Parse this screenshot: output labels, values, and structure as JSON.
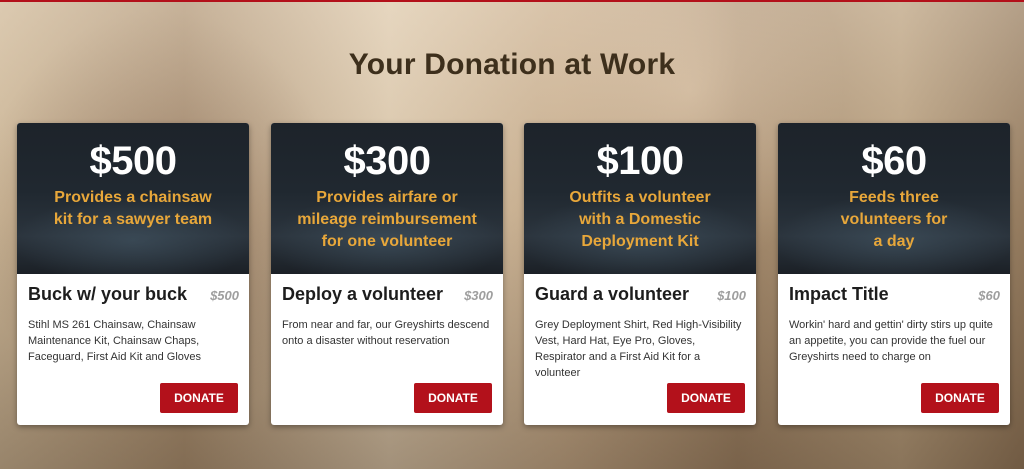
{
  "section": {
    "title": "Your Donation at Work"
  },
  "cards": [
    {
      "amount": "$500",
      "hero_text": "Provides a chainsaw kit for a sawyer team",
      "title": "Buck w/ your buck",
      "price": "$500",
      "description": "Stihl MS 261 Chainsaw, Chainsaw Maintenance Kit, Chainsaw Chaps, Faceguard, First Aid Kit and Gloves",
      "button": "DONATE"
    },
    {
      "amount": "$300",
      "hero_text": "Provides airfare or mileage reimbursement for one volunteer",
      "title": "Deploy a volunteer",
      "price": "$300",
      "description": "From near and far, our Greyshirts descend onto a disaster without reservation",
      "button": "DONATE"
    },
    {
      "amount": "$100",
      "hero_text": "Outfits a volunteer with a Domestic Deployment Kit",
      "title": "Guard a volunteer",
      "price": "$100",
      "description": "Grey Deployment Shirt, Red High-Visibility Vest, Hard Hat, Eye Pro, Gloves, Respirator and a First Aid Kit for a volunteer",
      "button": "DONATE"
    },
    {
      "amount": "$60",
      "hero_text": "Feeds three volunteers for a day",
      "title": "Impact Title",
      "price": "$60",
      "description": "Workin' hard and gettin' dirty stirs up quite an appetite, you can provide the fuel our Greyshirts need to charge on",
      "button": "DONATE"
    }
  ],
  "colors": {
    "accent": "#b3111b",
    "hero_text": "#e8a73a",
    "title": "#3d2f1c"
  }
}
